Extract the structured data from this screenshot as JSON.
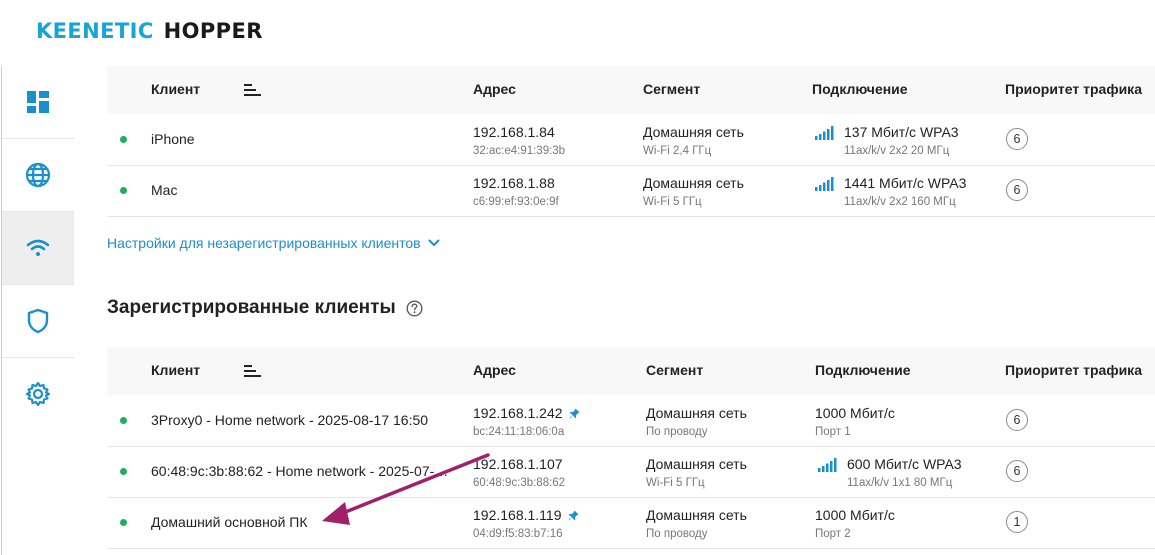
{
  "brand": {
    "part1": "KEENETIC",
    "part2": "HOPPER"
  },
  "sidebar": {
    "items": [
      {
        "name": "dashboard-icon",
        "active": false
      },
      {
        "name": "globe-icon",
        "active": false
      },
      {
        "name": "wifi-icon",
        "active": true
      },
      {
        "name": "shield-icon",
        "active": false
      },
      {
        "name": "gear-icon",
        "active": false
      }
    ]
  },
  "columns": {
    "client": "Клиент",
    "address": "Адрес",
    "segment": "Сегмент",
    "connection": "Подключение",
    "priority": "Приоритет трафика"
  },
  "unregistered": {
    "rows": [
      {
        "name": "iPhone",
        "ip": "192.168.1.84",
        "mac": "32:ac:e4:91:39:3b",
        "segment": "Домашняя сеть",
        "segment_sub": "Wi-Fi 2,4 ГГц",
        "connection": "137 Мбит/с  WPA3",
        "connection_sub": "11ax/k/v 2x2 20 МГц",
        "priority": "6",
        "wifi": true,
        "pinned": false
      },
      {
        "name": "Mac",
        "ip": "192.168.1.88",
        "mac": "c6:99:ef:93:0e:9f",
        "segment": "Домашняя сеть",
        "segment_sub": "Wi-Fi 5 ГГц",
        "connection": "1441 Мбит/с  WPA3",
        "connection_sub": "11ax/k/v 2x2 160 МГц",
        "priority": "6",
        "wifi": true,
        "pinned": false
      }
    ]
  },
  "unregistered_settings_link": "Настройки для незарегистрированных клиентов",
  "registered": {
    "title": "Зарегистрированные клиенты",
    "rows": [
      {
        "name": "3Proxy0 - Home network - 2025-08-17 16:50",
        "ip": "192.168.1.242",
        "mac": "bc:24:11:18:06:0a",
        "segment": "Домашняя сеть",
        "segment_sub": "По проводу",
        "connection": "1000 Мбит/с",
        "connection_sub": "Порт 1",
        "priority": "6",
        "wifi": false,
        "pinned": true
      },
      {
        "name": "60:48:9c:3b:88:62 - Home network - 2025-07-3...",
        "ip": "192.168.1.107",
        "mac": "60:48:9c:3b:88:62",
        "segment": "Домашняя сеть",
        "segment_sub": "Wi-Fi 5 ГГц",
        "connection": "600 Мбит/с  WPA3",
        "connection_sub": "11ax/k/v 1x1 80 МГц",
        "priority": "6",
        "wifi": true,
        "pinned": false
      },
      {
        "name": "Домашний основной ПК",
        "ip": "192.168.1.119",
        "mac": "04:d9:f5:83:b7:16",
        "segment": "Домашняя сеть",
        "segment_sub": "По проводу",
        "connection": "1000 Мбит/с",
        "connection_sub": "Порт 2",
        "priority": "1",
        "wifi": false,
        "pinned": true
      }
    ]
  },
  "colors": {
    "accent": "#1a8fd0",
    "brand_blue": "#19a4d6",
    "online": "#1fad5c",
    "annotation_arrow": "#a0206b"
  }
}
